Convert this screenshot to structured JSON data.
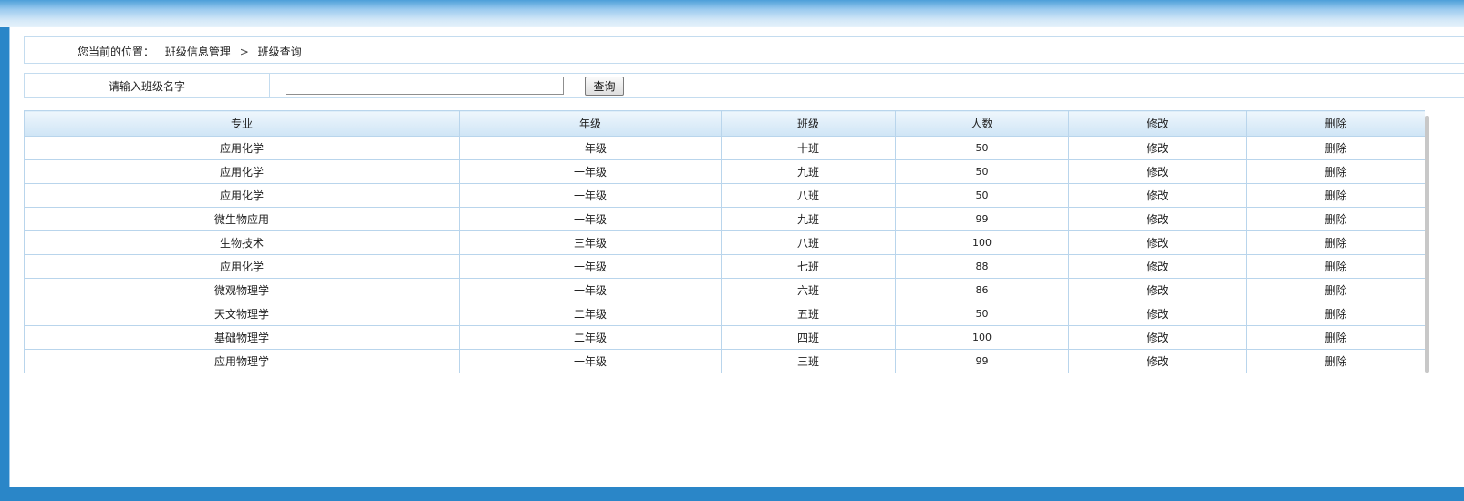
{
  "breadcrumb": {
    "prefix": "您当前的位置：",
    "items": [
      "班级信息管理",
      "班级查询"
    ],
    "separator": ">"
  },
  "search": {
    "label": "请输入班级名字",
    "value": "",
    "placeholder": "",
    "button_label": "查询"
  },
  "table": {
    "headers": [
      "专业",
      "年级",
      "班级",
      "人数",
      "修改",
      "删除"
    ],
    "rows": [
      {
        "major": "应用化学",
        "grade": "一年级",
        "class_name": "十班",
        "count": "50",
        "edit": "修改",
        "delete": "删除"
      },
      {
        "major": "应用化学",
        "grade": "一年级",
        "class_name": "九班",
        "count": "50",
        "edit": "修改",
        "delete": "删除"
      },
      {
        "major": "应用化学",
        "grade": "一年级",
        "class_name": "八班",
        "count": "50",
        "edit": "修改",
        "delete": "删除"
      },
      {
        "major": "微生物应用",
        "grade": "一年级",
        "class_name": "九班",
        "count": "99",
        "edit": "修改",
        "delete": "删除"
      },
      {
        "major": "生物技术",
        "grade": "三年级",
        "class_name": "八班",
        "count": "100",
        "edit": "修改",
        "delete": "删除"
      },
      {
        "major": "应用化学",
        "grade": "一年级",
        "class_name": "七班",
        "count": "88",
        "edit": "修改",
        "delete": "删除"
      },
      {
        "major": "微观物理学",
        "grade": "一年级",
        "class_name": "六班",
        "count": "86",
        "edit": "修改",
        "delete": "删除"
      },
      {
        "major": "天文物理学",
        "grade": "二年级",
        "class_name": "五班",
        "count": "50",
        "edit": "修改",
        "delete": "删除"
      },
      {
        "major": "基础物理学",
        "grade": "二年级",
        "class_name": "四班",
        "count": "100",
        "edit": "修改",
        "delete": "删除"
      },
      {
        "major": "应用物理学",
        "grade": "一年级",
        "class_name": "三班",
        "count": "99",
        "edit": "修改",
        "delete": "删除"
      }
    ]
  },
  "colors": {
    "frame": "#2a86c8",
    "border": "#b9d5ec",
    "header_top": "#eef6fc",
    "header_bottom": "#cfe5f6"
  }
}
